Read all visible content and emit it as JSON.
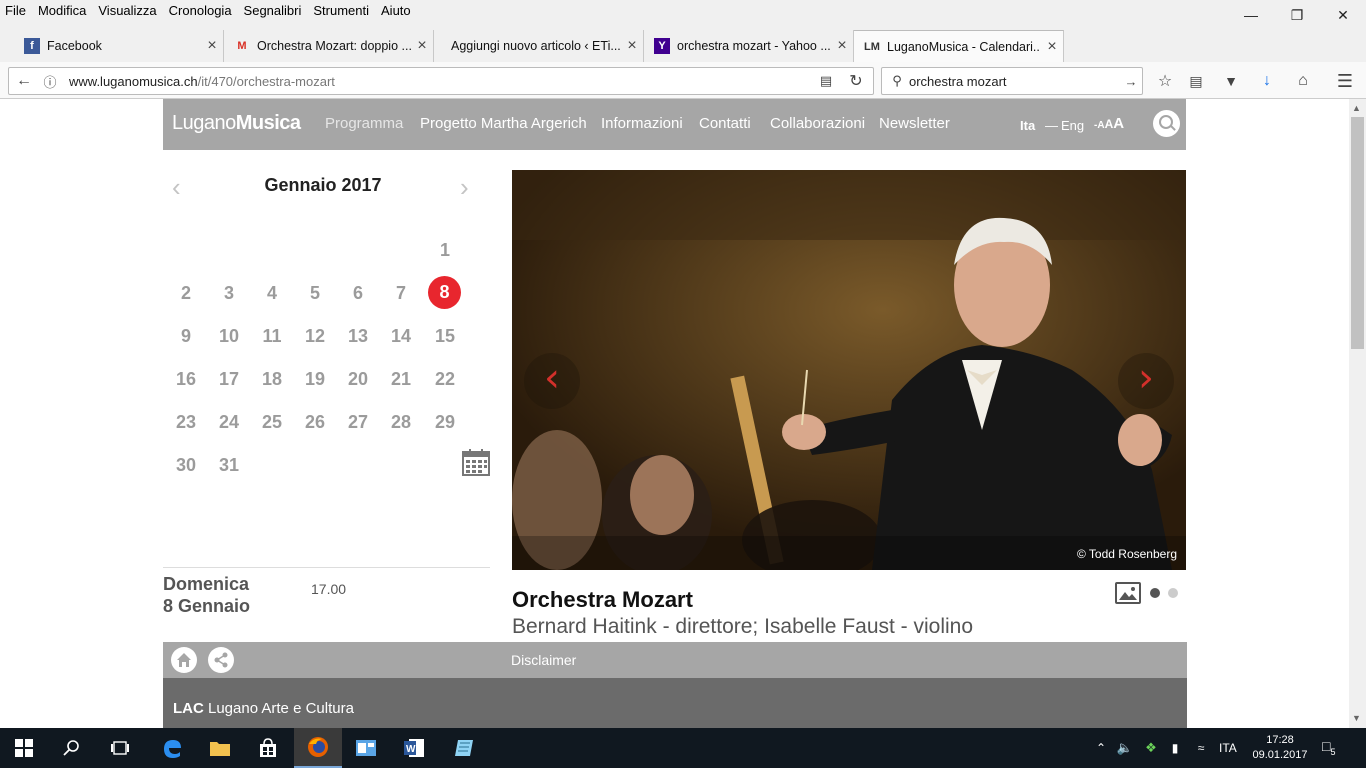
{
  "menubar": [
    "File",
    "Modifica",
    "Visualizza",
    "Cronologia",
    "Segnalibri",
    "Strumenti",
    "Aiuto"
  ],
  "tabs": [
    {
      "title": "Facebook",
      "icon": "facebook-icon"
    },
    {
      "title": "Orchestra Mozart: doppio ...",
      "icon": "gmail-icon"
    },
    {
      "title": "Aggiungi nuovo articolo ‹ ETi...",
      "icon": "none"
    },
    {
      "title": "orchestra mozart - Yahoo ...",
      "icon": "yahoo-icon"
    },
    {
      "title": "LuganoMusica - Calendari...",
      "icon": "lm-icon",
      "favicon_text": "LM"
    }
  ],
  "address": {
    "host": "www.luganomusica.ch",
    "path": "/it/470/orchestra-mozart"
  },
  "search": {
    "query": "orchestra mozart"
  },
  "site": {
    "logo_light": "Lugano",
    "logo_bold": "Musica",
    "nav": [
      "Programma",
      "Progetto Martha Argerich",
      "Informazioni",
      "Contatti",
      "Collaborazioni",
      "Newsletter"
    ],
    "lang_ita": "Ita",
    "lang_sep": "—",
    "lang_eng": "Eng",
    "fontsize_small": "-",
    "fontsize_a1": "A",
    "fontsize_a2": "A",
    "fontsize_a3": "A"
  },
  "calendar": {
    "title": "Gennaio 2017",
    "prev": "‹",
    "next": "›",
    "days": [
      "1",
      "2",
      "3",
      "4",
      "5",
      "6",
      "7",
      "8",
      "9",
      "10",
      "11",
      "12",
      "13",
      "14",
      "15",
      "16",
      "17",
      "18",
      "19",
      "20",
      "21",
      "22",
      "23",
      "24",
      "25",
      "26",
      "27",
      "28",
      "29",
      "30",
      "31"
    ],
    "today": "8"
  },
  "event": {
    "day_line1": "Domenica",
    "day_line2": "8 Gennaio",
    "time": "17.00",
    "title": "Orchestra Mozart",
    "subtitle": "Bernard Haitink - direttore; Isabelle Faust - violino",
    "photo_credit": "© Todd Rosenberg"
  },
  "footer": {
    "disclaimer": "Disclaimer",
    "lac_bold": "LAC",
    "lac_text": " Lugano Arte e Cultura"
  },
  "taskbar": {
    "lang": "ITA",
    "time": "17:28",
    "date": "09.01.2017",
    "notifications": "5"
  },
  "colors": {
    "header_gray": "#a6a6a6",
    "today_red": "#e8262e",
    "arrow_red": "#d3302b"
  }
}
